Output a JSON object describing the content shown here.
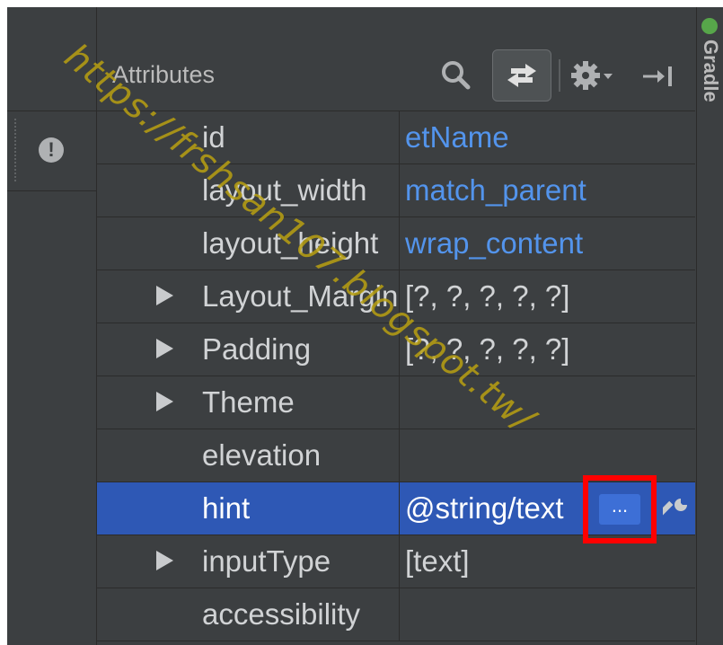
{
  "panel": {
    "title": "Attributes",
    "toolbar": {
      "search_icon": "search-icon",
      "swap_icon": "swap-arrows-icon",
      "settings_icon": "gear-icon",
      "hide_icon": "pin-right-icon"
    }
  },
  "gutter": {
    "warning_symbol": "!"
  },
  "attributes": [
    {
      "name": "id",
      "value": "etName",
      "expandable": false,
      "value_style": "blue"
    },
    {
      "name": "layout_width",
      "value": "match_parent",
      "expandable": false,
      "value_style": "blue"
    },
    {
      "name": "layout_height",
      "value": "wrap_content",
      "expandable": false,
      "value_style": "blue"
    },
    {
      "name": "Layout_Margin",
      "value": "[?, ?, ?, ?, ?]",
      "expandable": true,
      "value_style": "plain"
    },
    {
      "name": "Padding",
      "value": "[?, ?, ?, ?, ?]",
      "expandable": true,
      "value_style": "plain"
    },
    {
      "name": "Theme",
      "value": "",
      "expandable": true,
      "value_style": "plain"
    },
    {
      "name": "elevation",
      "value": "",
      "expandable": false,
      "value_style": "plain"
    },
    {
      "name": "hint",
      "value": "@string/text",
      "expandable": false,
      "value_style": "selected",
      "selected": true,
      "browse_label": "..."
    },
    {
      "name": "inputType",
      "value": "[text]",
      "expandable": true,
      "value_style": "plain"
    },
    {
      "name": "accessibility",
      "value": "",
      "expandable": false,
      "value_style": "plain"
    }
  ],
  "sidebar": {
    "label": "Gradle"
  },
  "watermark": "https://frshsan107.blogspot.tw/",
  "colors": {
    "background": "#3c3f41",
    "selection": "#2e58b5",
    "value_blue": "#5394ec",
    "highlight_box": "#ff0000"
  }
}
